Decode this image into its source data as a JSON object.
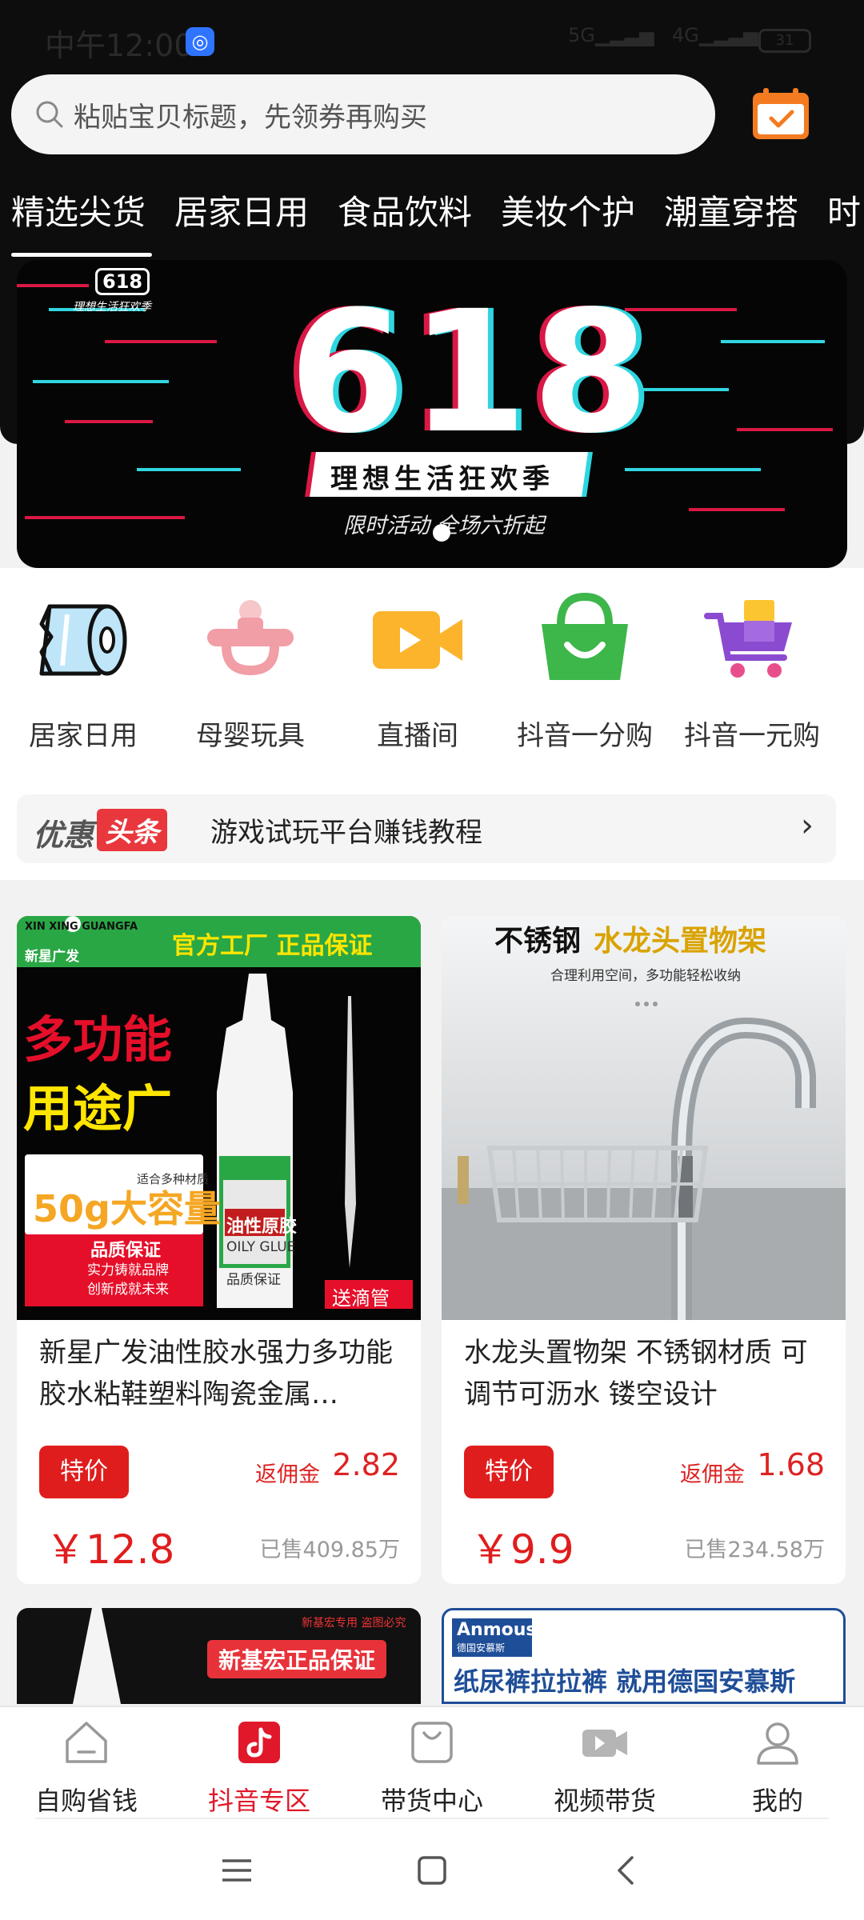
{
  "status_bar": {
    "time": "中午12:00",
    "network1": "5G",
    "network2": "4G",
    "battery": "31"
  },
  "search": {
    "placeholder": "粘贴宝贝标题，先领券再购买",
    "icon": "search-icon",
    "side_icon": "calendar-check-icon"
  },
  "tabs": [
    {
      "label": "精选尖货",
      "active": true
    },
    {
      "label": "居家日用",
      "active": false
    },
    {
      "label": "食品饮料",
      "active": false
    },
    {
      "label": "美妆个护",
      "active": false
    },
    {
      "label": "潮童穿搭",
      "active": false
    },
    {
      "label": "时",
      "active": false
    }
  ],
  "banner": {
    "logo_text": "618",
    "logo_sub": "理想生活狂欢季",
    "headline": "618",
    "ribbon": "理想生活狂欢季",
    "subtitle": "限时活动 全场六折起",
    "colors": {
      "red": "#d91845",
      "cyan": "#2fd6e0"
    }
  },
  "categories": [
    {
      "label": "居家日用",
      "icon": "toilet-paper-icon"
    },
    {
      "label": "母婴玩具",
      "icon": "pacifier-icon"
    },
    {
      "label": "直播间",
      "icon": "video-camera-icon"
    },
    {
      "label": "抖音一分购",
      "icon": "shopping-bag-icon"
    },
    {
      "label": "抖音一元购",
      "icon": "shopping-cart-icon"
    }
  ],
  "news": {
    "brand_left": "优惠",
    "brand_right": "头条",
    "text": "游戏试玩平台赚钱教程",
    "arrow": "›"
  },
  "products": [
    {
      "title": "新星广发油性胶水强力多功能胶水粘鞋塑料陶瓷金属…",
      "badge": "特价",
      "rebate_label": "返佣金",
      "rebate": "2.82",
      "price": "￥12.8",
      "sold": "已售409.85万",
      "image": {
        "brand_en": "XIN XING GUANGFA",
        "brand_cn": "新星广发",
        "banner": "官方工厂  正品保证",
        "line1": "多功能",
        "line2": "用途广",
        "capacity": "50g大容量",
        "capacity_tag": "适合多种材质",
        "quality": "品质保证",
        "quality_sub1": "实力铸就品牌",
        "quality_sub2": "创新成就未来",
        "bottle_label": "油性原胶",
        "bottle_en": "OILY GLUE",
        "bottle_foot": "品质保证",
        "gift": "送滴管"
      }
    },
    {
      "title": "水龙头置物架 不锈钢材质 可调节可沥水 镂空设计",
      "badge": "特价",
      "rebate_label": "返佣金",
      "rebate": "1.68",
      "price": "￥9.9",
      "sold": "已售234.58万",
      "image": {
        "headline_a": "不锈钢",
        "headline_b": "水龙头置物架",
        "sub": "合理利用空间，多功能轻松收纳"
      }
    }
  ],
  "next_cards": [
    {
      "top_note": "新基宏专用  盗图必究",
      "banner": "新基宏正品保证"
    },
    {
      "brand": "Anmous",
      "brand_sub": "德国安慕斯",
      "banner": "纸尿裤拉拉裤 就用德国安慕斯"
    }
  ],
  "bottom_nav": [
    {
      "label": "自购省钱",
      "icon": "home-icon",
      "active": false
    },
    {
      "label": "抖音专区",
      "icon": "tiktok-icon",
      "active": true
    },
    {
      "label": "带货中心",
      "icon": "shopping-bag-icon",
      "active": false
    },
    {
      "label": "视频带货",
      "icon": "video-icon",
      "active": false
    },
    {
      "label": "我的",
      "icon": "user-icon",
      "active": false
    }
  ],
  "system_nav": [
    "menu-icon",
    "home-square-icon",
    "back-icon"
  ]
}
